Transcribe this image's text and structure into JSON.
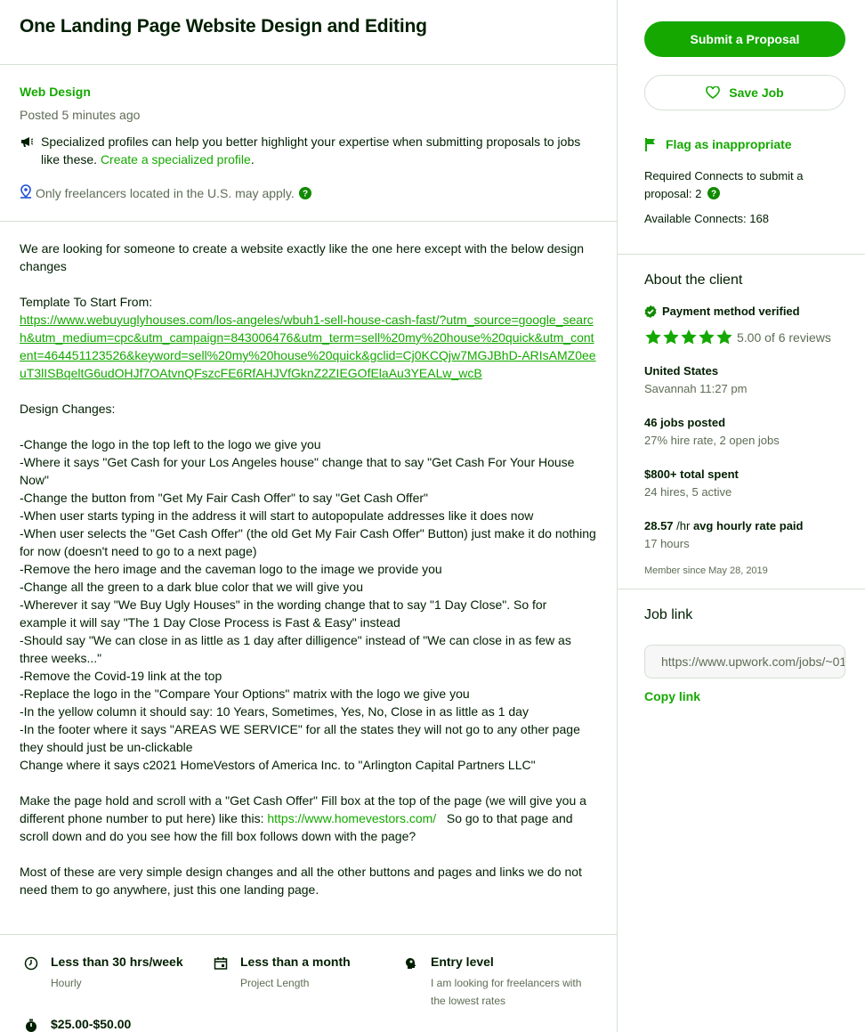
{
  "job": {
    "title": "One Landing Page Website Design and Editing",
    "category": "Web Design",
    "posted": "Posted 5 minutes ago",
    "specialized_note": "Specialized profiles can help you better highlight your expertise when submitting proposals to jobs like these.",
    "specialized_link": "Create a specialized profile",
    "location_note": "Only freelancers located in the U.S. may apply."
  },
  "description": {
    "intro": "We are looking for someone to create a website exactly like the one here except with the below design changes",
    "template_label": "Template To Start From:",
    "template_url": "https://www.webuyuglyhouses.com/los-angeles/wbuh1-sell-house-cash-fast/?utm_source=google_search&utm_medium=cpc&utm_campaign=843006476&utm_term=sell%20my%20house%20quick&utm_content=464451123526&keyword=sell%20my%20house%20quick&gclid=Cj0KCQjw7MGJBhD-ARIsAMZ0eeuT3lISBqeltG6udOHJf7OAtvnQFszcFE6RfAHJVfGknZ2ZIEGOfElaAu3YEALw_wcB",
    "changes_label": "Design Changes:",
    "changes": "-Change the logo in the top left to the logo we give you\n-Where it says \"Get Cash for your Los Angeles house\" change that to say \"Get Cash For Your House Now\"\n-Change the button from \"Get My Fair Cash Offer\" to say \"Get Cash Offer\"\n-When user starts typing in the address it will start to autopopulate addresses like it does now\n-When user selects the \"Get Cash Offer\" (the old Get My Fair Cash Offer\" Button) just make it do nothing for now (doesn't need to go to a next page)\n-Remove the hero image and the caveman logo to the image we provide you\n-Change all the green to a dark blue color that we will give you\n-Wherever it say \"We Buy Ugly Houses\" in the wording change that to say \"1 Day Close\".  So for example it will say \"The 1 Day Close Process is Fast & Easy\" instead\n-Should say \"We can close in as little as 1 day after dilligence\" instead of \"We can close in as few as three weeks...\"\n-Remove the Covid-19 link at the top\n-Replace the logo in the \"Compare Your Options\" matrix with the logo we give you\n-In the yellow column it should say: 10 Years, Sometimes, Yes, No, Close in as little as 1 day\n-In the footer where it says \"AREAS WE SERVICE\" for all the states they will not go to any other page they should just be un-clickable\nChange where it says c2021 HomeVestors of America Inc. to \"Arlington Capital Partners LLC\"",
    "scroll_pre": "Make the page hold and scroll with a \"Get Cash Offer\" Fill box at the top of the page (we will give you a different phone number to put here) like this: ",
    "scroll_url": "https://www.homevestors.com/",
    "scroll_post": "   So go to that page and scroll down and do you see how the fill box follows down with the page?",
    "closing": "Most of these are very simple design changes and all the other buttons and pages and links we do not need them to go anywhere, just this one landing page."
  },
  "features": {
    "hours": "Less than 30 hrs/week",
    "hours_sub": "Hourly",
    "length": "Less than a month",
    "length_sub": "Project Length",
    "level": "Entry level",
    "level_sub": "I am looking for freelancers with the lowest rates",
    "rate": "$25.00-$50.00"
  },
  "sidebar": {
    "submit_label": "Submit a Proposal",
    "save_label": "Save Job",
    "flag_label": "Flag as inappropriate",
    "required_connects": "Required Connects to submit a proposal: 2",
    "available_connects": "Available Connects: 168"
  },
  "client": {
    "heading": "About the client",
    "payment": "Payment method verified",
    "rating": 5.0,
    "rating_text": "5.00 of 6 reviews",
    "country": "United States",
    "city_time": "Savannah 11:27 pm",
    "jobs_posted": "46 jobs posted",
    "hire_rate": "27% hire rate, 2 open jobs",
    "total_spent": "$800+ total spent",
    "hires": "24 hires, 5 active",
    "avg_rate_value": "28.57",
    "avg_rate_unit": " /hr",
    "avg_rate_label": " avg hourly rate paid",
    "hours": "17 hours",
    "member_since": "Member since May 28, 2019"
  },
  "joblink": {
    "heading": "Job link",
    "url": "https://www.upwork.com/jobs/~01",
    "copy_label": "Copy link"
  },
  "colors": {
    "brand_green": "#14a800",
    "text": "#001e00",
    "muted": "#5e6d55",
    "divider": "#d5e0d5"
  }
}
